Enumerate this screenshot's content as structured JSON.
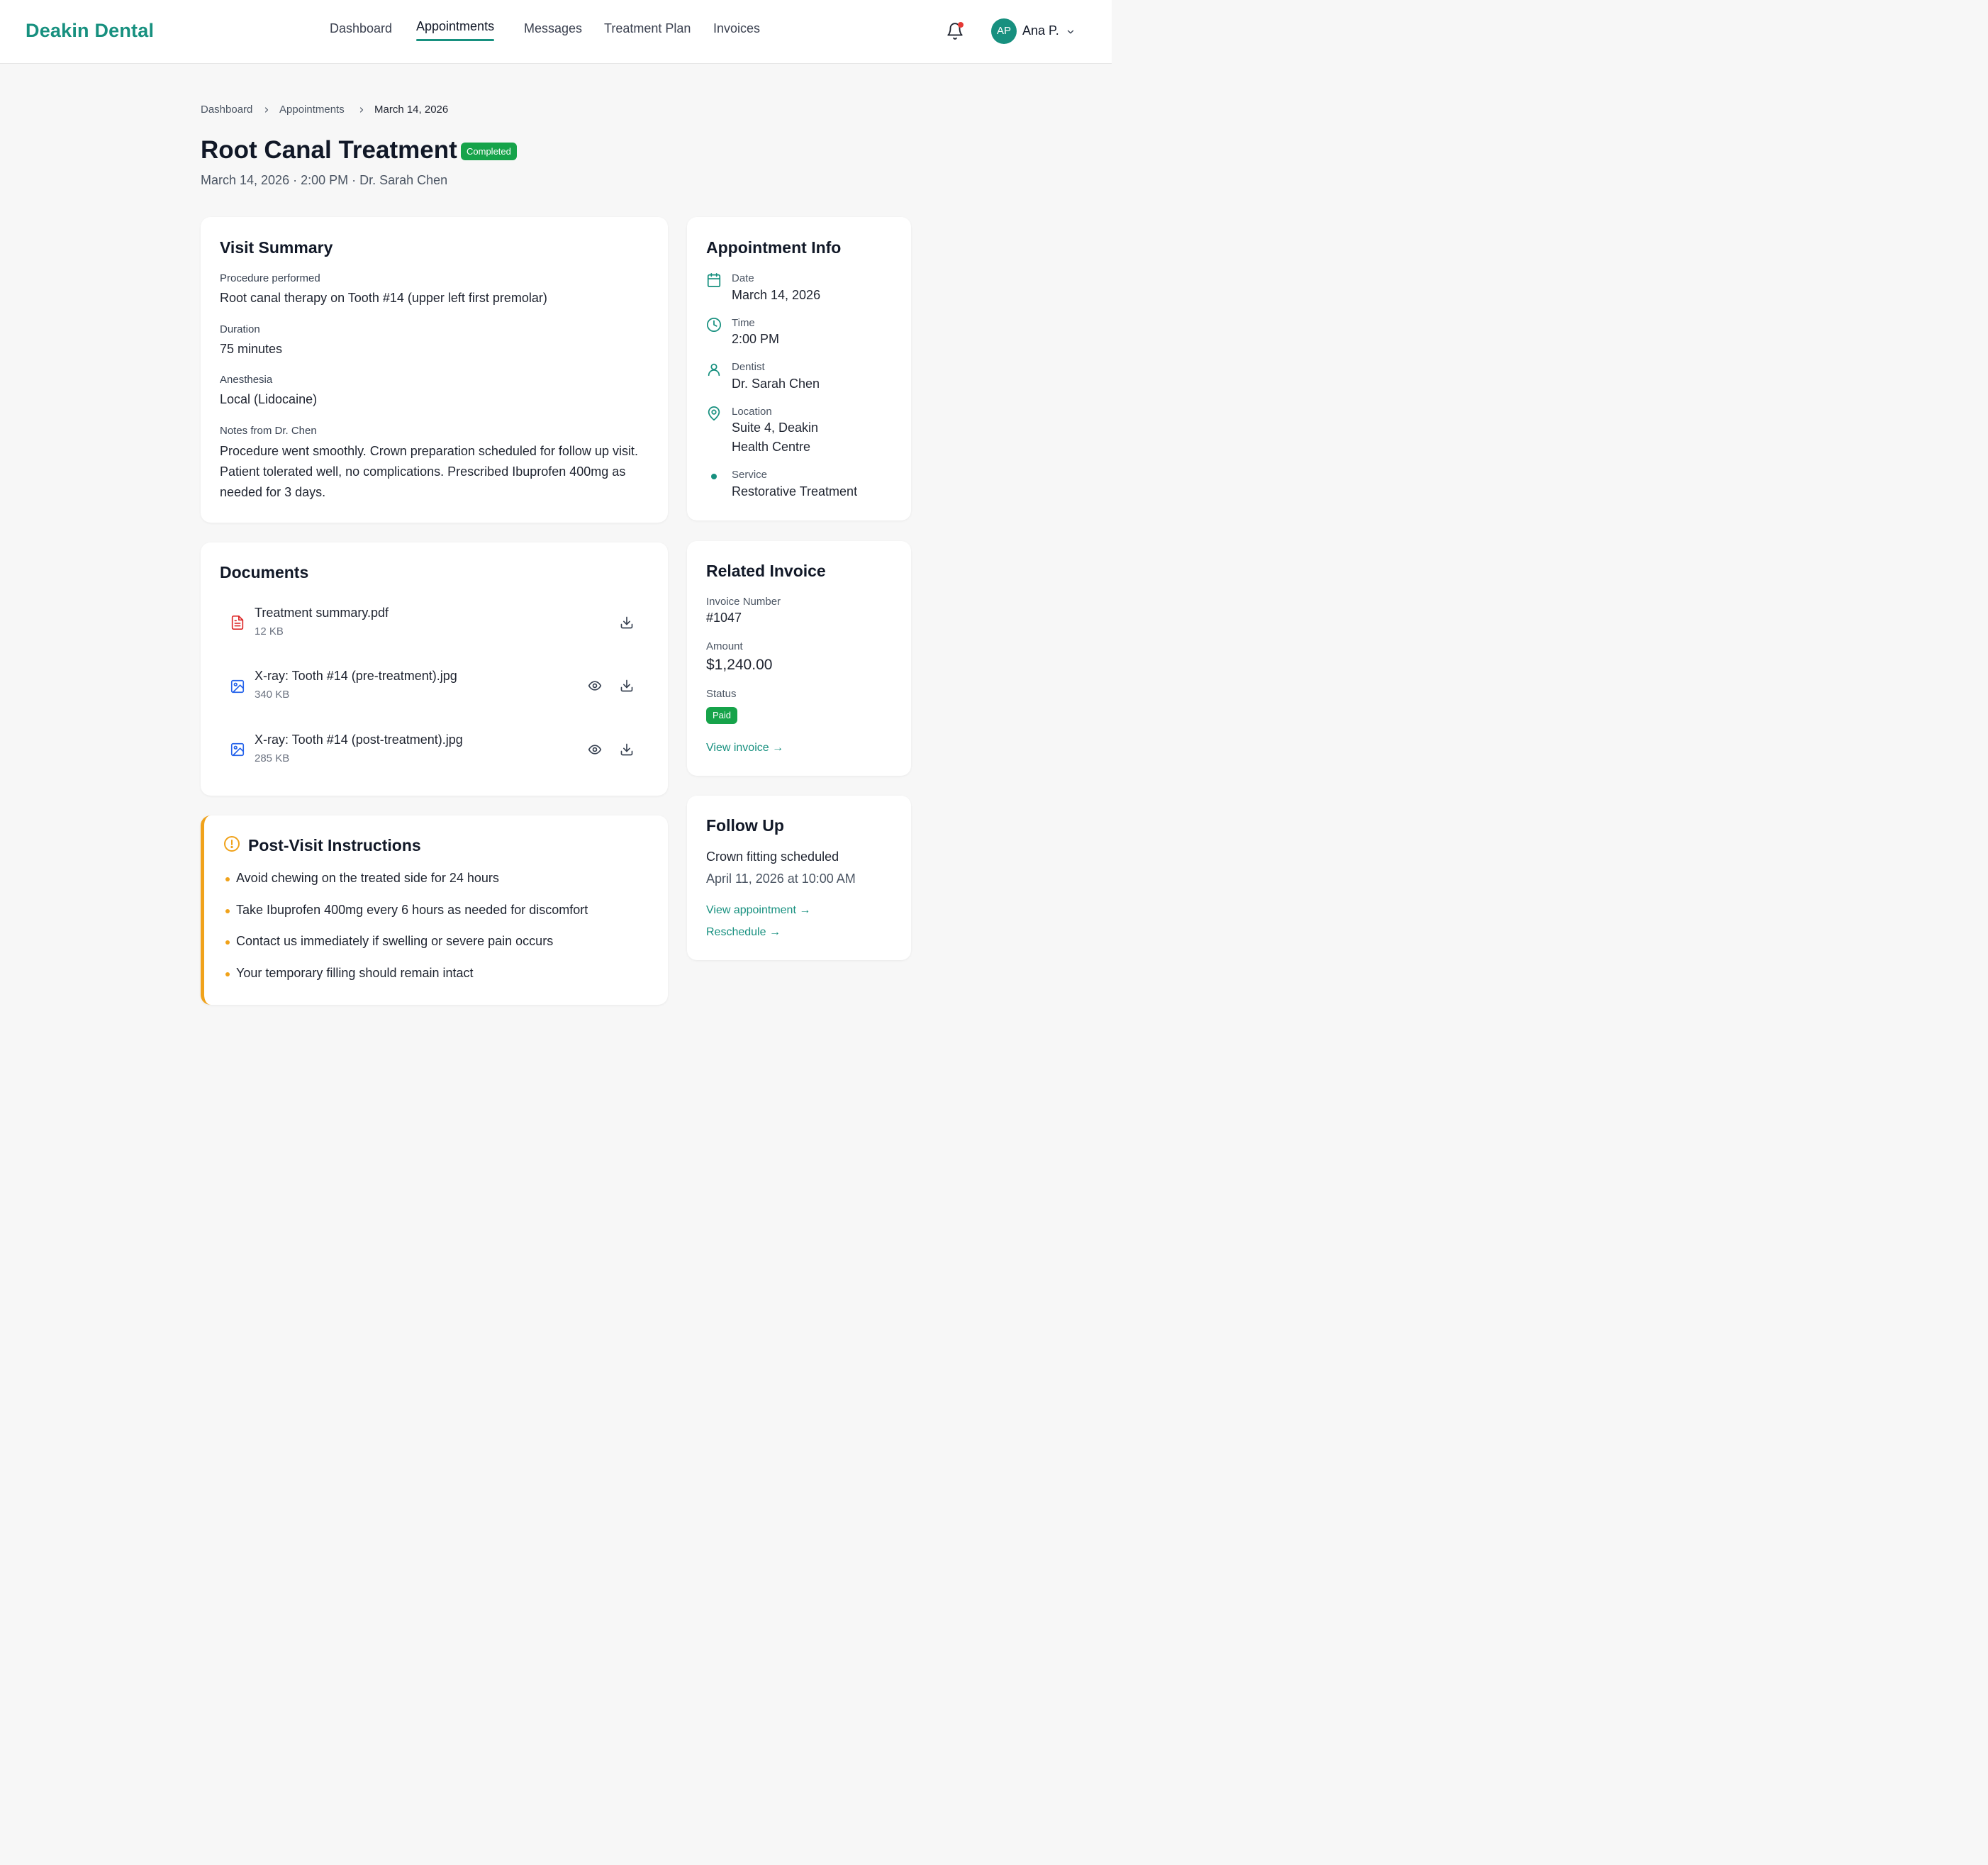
{
  "brand": "Deakin Dental",
  "nav": {
    "items": [
      "Dashboard",
      "Appointments",
      "Messages",
      "Treatment Plan",
      "Invoices"
    ],
    "active": "Appointments"
  },
  "user": {
    "initials": "AP",
    "name": "Ana P."
  },
  "breadcrumb": [
    "Dashboard",
    "Appointments",
    "March 14, 2026"
  ],
  "header": {
    "title": "Root Canal Treatment",
    "status": "Completed",
    "subtitle": "March 14, 2026 · 2:00 PM · Dr. Sarah Chen"
  },
  "visit_summary": {
    "title": "Visit Summary",
    "procedure_label": "Procedure performed",
    "procedure": "Root canal therapy on Tooth #14 (upper left first premolar)",
    "duration_label": "Duration",
    "duration": "75 minutes",
    "anesthesia_label": "Anesthesia",
    "anesthesia": "Local (Lidocaine)",
    "notes_label": "Notes from Dr. Chen",
    "notes": "Procedure went smoothly. Crown preparation scheduled for follow up visit. Patient tolerated well, no complications. Prescribed Ibuprofen 400mg as needed for 3 days."
  },
  "documents": {
    "title": "Documents",
    "items": [
      {
        "name": "Treatment summary.pdf",
        "size": "12 KB",
        "icon": "pdf-icon"
      },
      {
        "name": "X-ray: Tooth #14 (pre-treatment).jpg",
        "size": "340 KB",
        "icon": "image-icon"
      },
      {
        "name": "X-ray: Tooth #14 (post-treatment).jpg",
        "size": "285 KB",
        "icon": "image-icon"
      }
    ]
  },
  "instructions": {
    "title": "Post-Visit Instructions",
    "items": [
      "Avoid chewing on the treated side for 24 hours",
      "Take Ibuprofen 400mg every 6 hours as needed for discomfort",
      "Contact us immediately if swelling or severe pain occurs",
      "Your temporary filling should remain intact"
    ]
  },
  "appointment_info": {
    "title": "Appointment Info",
    "date_label": "Date",
    "date": "March 14, 2026",
    "time_label": "Time",
    "time": "2:00 PM",
    "dentist_label": "Dentist",
    "dentist": "Dr. Sarah Chen",
    "location_label": "Location",
    "location_line1": "Suite 4, Deakin",
    "location_line2": "Health Centre",
    "service_label": "Service",
    "service": "Restorative Treatment"
  },
  "invoice": {
    "title": "Related Invoice",
    "number_label": "Invoice Number",
    "number": "#1047",
    "amount_label": "Amount",
    "amount": "$1,240.00",
    "status_label": "Status",
    "status": "Paid",
    "link": "View invoice →"
  },
  "follow_up": {
    "title": "Follow Up",
    "headline": "Crown fitting scheduled",
    "datetime": "April 11, 2026 at 10:00 AM",
    "view_link": "View appointment →",
    "reschedule_link": "Reschedule →"
  },
  "colors": {
    "brand": "#17907f",
    "success": "#16a34a",
    "warning": "#f0a21a",
    "pdf": "#dc2626",
    "image": "#2563eb",
    "notification": "#e53935"
  }
}
